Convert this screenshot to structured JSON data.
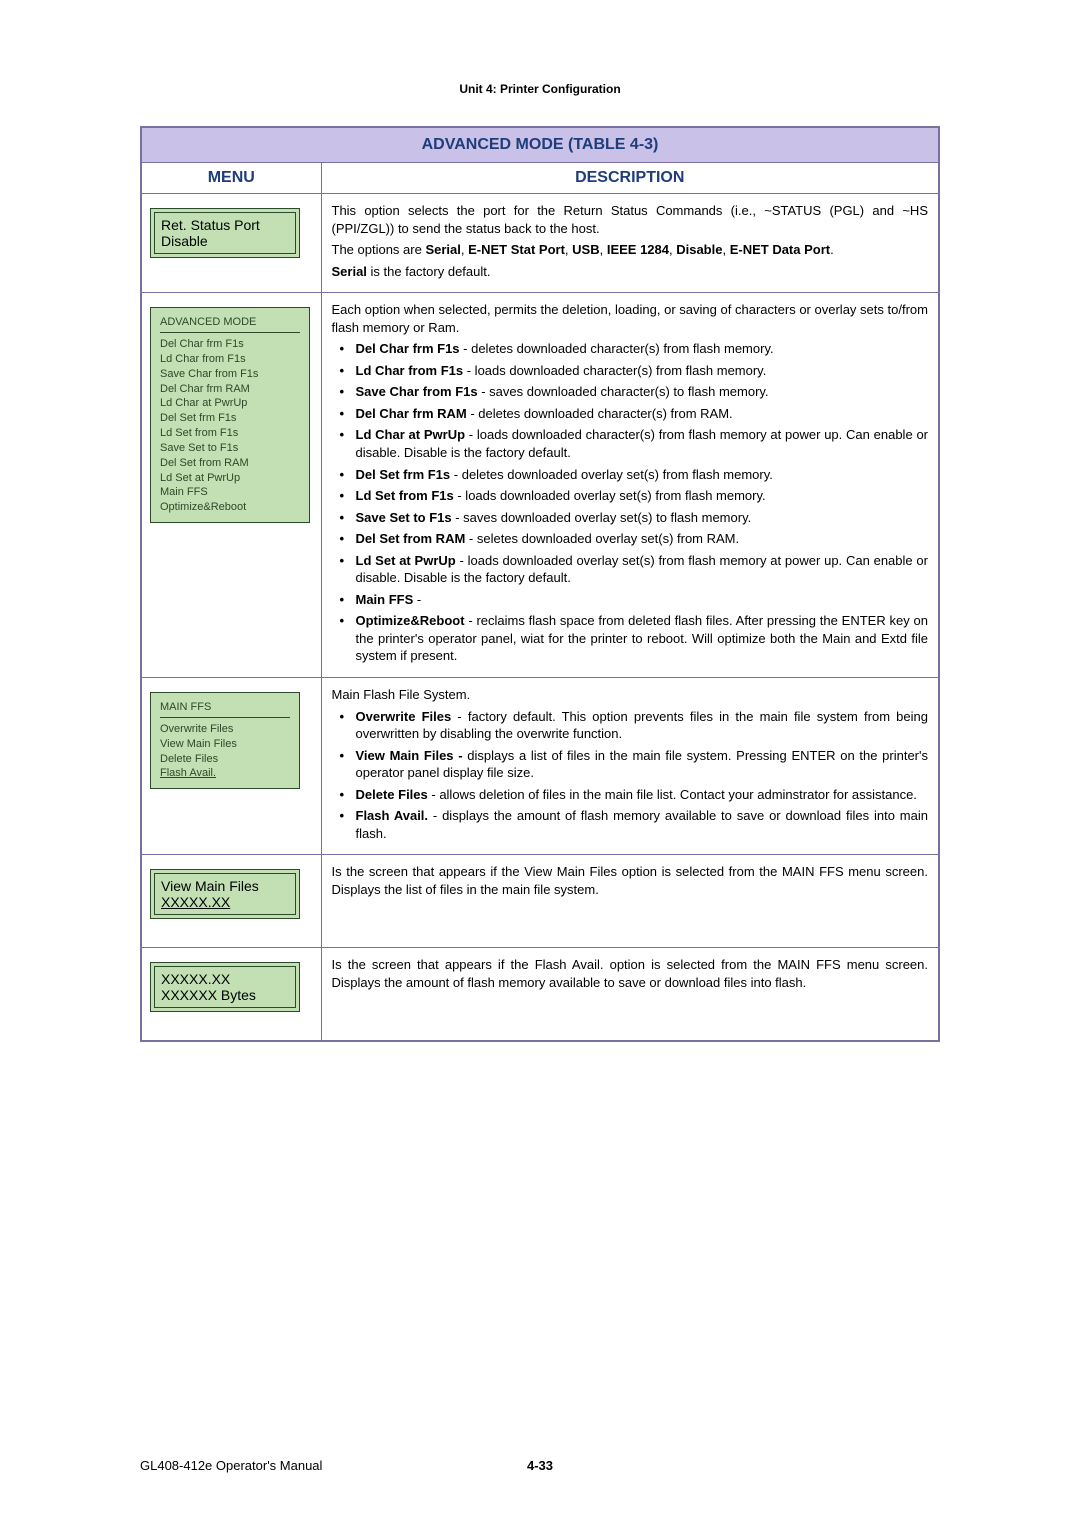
{
  "header": "Unit 4:  Printer Configuration",
  "table_title": "ADVANCED MODE (TABLE 4-3)",
  "col_menu": "MENU",
  "col_desc": "DESCRIPTION",
  "rows": [
    {
      "menu_lines": [
        "Ret. Status Port",
        "Disable"
      ],
      "menu_style": "nested",
      "desc_paras": [
        {
          "text": "This option selects the port for the Return Status Commands (i.e., ~STATUS (PGL) and ~HS (PPI/ZGL)) to send the status back to the host."
        },
        {
          "html": "The options are <b>Serial</b>, <b>E-NET Stat Port</b>, <b>USB</b>, <b>IEEE 1284</b>, <b>Disable</b>, <b>E-NET Data Port</b>."
        },
        {
          "html": "<b>Serial</b> is the factory default."
        }
      ]
    },
    {
      "menu_title": "ADVANCED MODE",
      "menu_lines": [
        "Del Char frm F1s",
        "Ld Char from F1s",
        "Save Char from F1s",
        "Del Char frm RAM",
        "Ld Char at PwrUp",
        "Del Set frm F1s",
        "Ld Set from F1s",
        "Save Set to F1s",
        "Del Set from RAM",
        "Ld Set at PwrUp",
        "Main FFS",
        "Optimize&Reboot"
      ],
      "menu_style": "single",
      "desc_intro": "Each option when selected, permits the deletion, loading, or saving of characters or overlay sets to/from flash memory or Ram.",
      "bullets": [
        {
          "b": "Del Char frm F1s",
          "t": " - deletes downloaded character(s) from flash memory."
        },
        {
          "b": "Ld Char from F1s",
          "t": " -  loads downloaded character(s) from flash memory."
        },
        {
          "b": "Save Char from F1s",
          "t": " - saves downloaded character(s) to flash memory."
        },
        {
          "b": "Del Char frm RAM",
          "t": " - deletes downloaded character(s) from RAM."
        },
        {
          "b": "Ld Char at PwrUp",
          "t": " - loads downloaded character(s) from flash memory at power up. Can enable or disable. Disable is the factory default."
        },
        {
          "b": "Del Set frm F1s",
          "t": " - deletes downloaded overlay set(s) from flash memory."
        },
        {
          "b": "Ld Set from F1s",
          "t": " - loads downloaded overlay set(s) from flash memory."
        },
        {
          "b": "Save Set to F1s",
          "t": " - saves downloaded overlay set(s) to flash memory."
        },
        {
          "b": "Del Set from RAM",
          "t": " - seletes downloaded overlay set(s) from RAM."
        },
        {
          "b": "Ld Set at PwrUp",
          "t": " - loads downloaded overlay set(s) from flash memory at power up. Can enable or disable. Disable is the factory default."
        },
        {
          "b": "Main FFS",
          "t": " -"
        },
        {
          "b": "Optimize&Reboot",
          "t": " - reclaims flash space from deleted flash files. After pressing the ENTER key on the printer's operator panel, wiat for the printer to reboot. Will optimize both the Main and Extd file system if present."
        }
      ]
    },
    {
      "menu_title": "MAIN FFS",
      "menu_lines": [
        "Overwrite Files",
        "View Main Files",
        "Delete Files"
      ],
      "menu_last_underline": "Flash Avail.",
      "menu_style": "single",
      "desc_intro": "Main Flash File System.",
      "bullets": [
        {
          "b": "Overwrite Files",
          "t": " - factory default. This option prevents files in the main file system from being overwritten by disabling the overwrite function."
        },
        {
          "b": "View Main Files - ",
          "t": "displays a list of files in the main file system. Pressing ENTER on the printer's operator panel display file size."
        },
        {
          "b": "Delete Files",
          "t": " - allows deletion of files in the main file list. Contact your adminstrator for assistance."
        },
        {
          "b": "Flash Avail.",
          "t": " - displays the amount of flash memory available to save or download files into main flash."
        }
      ]
    },
    {
      "menu_lines": [
        "View Main Files",
        "XXXXX.XX"
      ],
      "menu_style": "nested",
      "desc_paras": [
        {
          "text": "Is the screen that appears if the View Main Files option is selected from the MAIN FFS menu screen. Displays the list of files in the main file system."
        }
      ]
    },
    {
      "menu_lines": [
        "XXXXX.XX",
        "XXXXXX Bytes"
      ],
      "menu_style": "nested",
      "desc_paras": [
        {
          "text": "Is the screen that appears if the Flash Avail. option is selected from the MAIN FFS menu screen. Displays the amount of flash memory available to save or download files into flash."
        }
      ]
    }
  ],
  "footer_left": "GL408-412e Operator's Manual",
  "footer_center": "4-33"
}
